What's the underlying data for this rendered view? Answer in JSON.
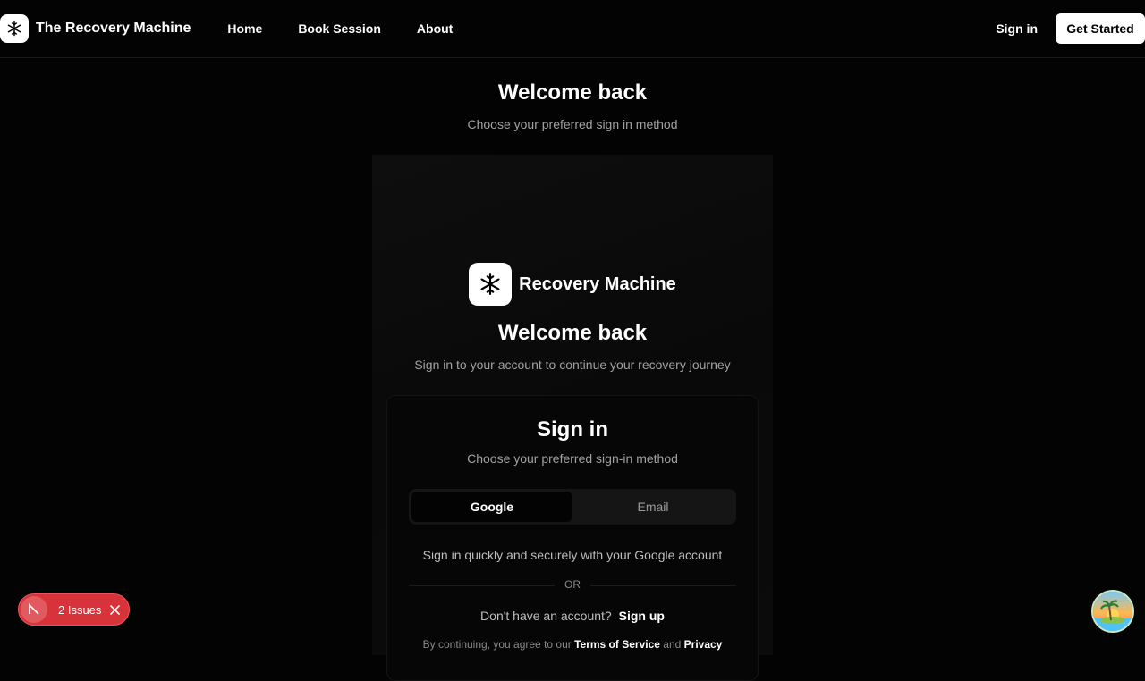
{
  "header": {
    "logo_icon": "snowflake-icon",
    "brand": "The Recovery Machine",
    "nav": [
      "Home",
      "Book Session",
      "About"
    ],
    "sign_in": "Sign in",
    "get_started": "Get Started"
  },
  "page": {
    "title": "Welcome back",
    "subtitle": "Choose your preferred sign in method"
  },
  "panel": {
    "logo_icon": "snowflake-icon",
    "brand": "Recovery Machine",
    "title": "Welcome back",
    "subtitle": "Sign in to your account to continue your recovery journey"
  },
  "card": {
    "title": "Sign in",
    "subtitle": "Choose your preferred sign-in method",
    "tabs": [
      {
        "label": "Google",
        "active": true
      },
      {
        "label": "Email",
        "active": false
      }
    ],
    "google_note": "Sign in quickly and securely with your Google account",
    "divider": "OR",
    "signup_prompt": "Don't have an account?",
    "signup_link": "Sign up",
    "terms_prefix": "By continuing, you agree to our",
    "terms_link": "Terms of Service",
    "terms_and": "and",
    "privacy_link": "Privacy"
  },
  "issues_badge": {
    "text": "2 Issues",
    "logo_icon": "n-logo-icon",
    "close_icon": "close-icon"
  },
  "avatar": {
    "icon": "island-sunset-avatar"
  },
  "colors": {
    "background": "#030303",
    "accent_white": "#ffffff",
    "muted_text": "#a1a1a1",
    "issues_red": "#d8333a"
  }
}
